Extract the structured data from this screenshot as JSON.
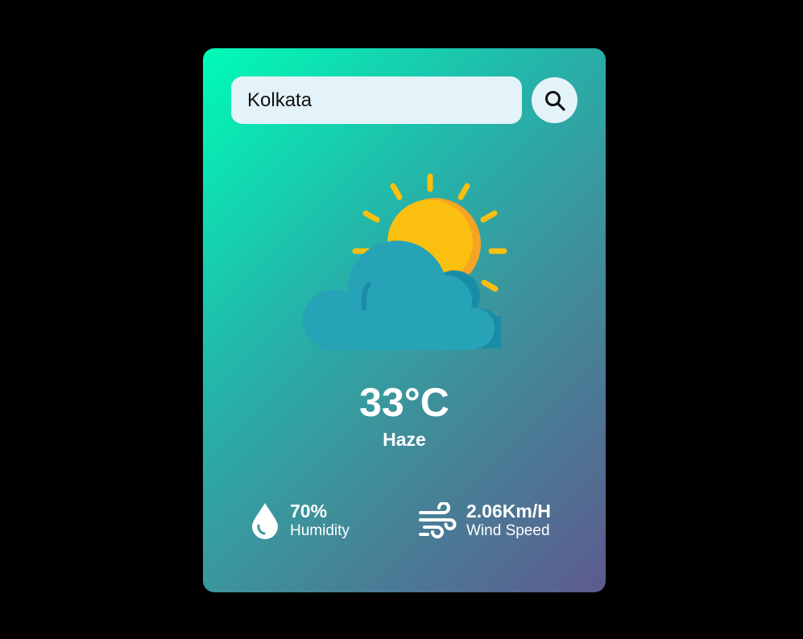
{
  "search": {
    "value": "Kolkata",
    "icon": "search-icon"
  },
  "weather": {
    "icon": "partly-cloudy-icon",
    "temperature": "33°C",
    "condition": "Haze"
  },
  "details": {
    "humidity": {
      "icon": "humidity-drop-icon",
      "value": "70%",
      "label": "Humidity"
    },
    "wind": {
      "icon": "wind-icon",
      "value": "2.06Km/H",
      "label": "Wind Speed"
    }
  },
  "colors": {
    "background": "#000000",
    "card_gradient_start": "#00fcb7",
    "card_gradient_end": "#5d5a8e",
    "input_bg": "#e4f3f9",
    "sun": "#fbbf0f",
    "sun_shade": "#f7a325",
    "cloud": "#27a3b8",
    "cloud_shade": "#1a8da6"
  }
}
